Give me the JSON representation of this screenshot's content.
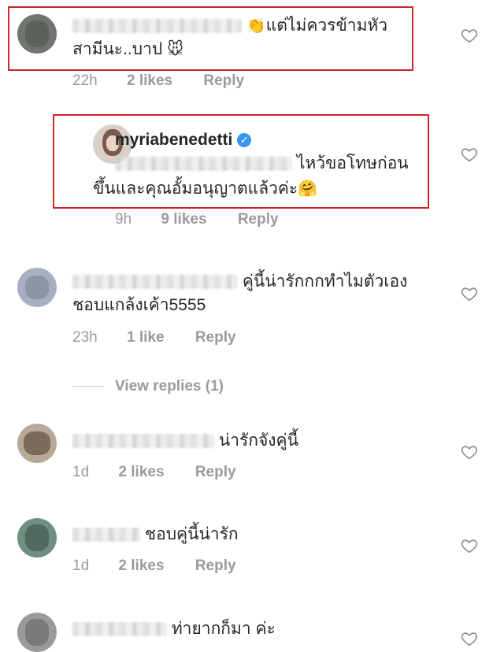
{
  "comments": [
    {
      "text_line1": "แต่ไม่ควรข้ามหัว",
      "text_line2": "สามีนะ..บาป",
      "emoji_pre": "👏",
      "emoji_post": "🐭",
      "time": "22h",
      "likes": "2 likes",
      "reply": "Reply"
    },
    {
      "username": "myriabenedetti",
      "text_line1": "ไหว้ขอโทษก่อน",
      "text_line2": "ขึ้นและคุณอั้มอนุญาตแล้วค่ะ",
      "emoji_post": "🤗",
      "time": "9h",
      "likes": "9 likes",
      "reply": "Reply"
    },
    {
      "text_line1": "คู่นี้น่ารักกกทำไมตัวเอง",
      "text_line2": "ชอบแกล้งเค้า5555",
      "time": "23h",
      "likes": "1 like",
      "reply": "Reply",
      "view_replies": "View replies (1)"
    },
    {
      "text_line1": "น่ารักจังคู่นี้",
      "time": "1d",
      "likes": "2 likes",
      "reply": "Reply"
    },
    {
      "text_line1": "ชอบคู่นี้น่ารัก",
      "time": "1d",
      "likes": "2 likes",
      "reply": "Reply"
    },
    {
      "text_line1": "ท่ายากก็มา ค่ะ"
    }
  ],
  "colors": {
    "highlight_box": "#d0242b",
    "verified": "#3897f0",
    "meta": "#9a9a9a"
  }
}
